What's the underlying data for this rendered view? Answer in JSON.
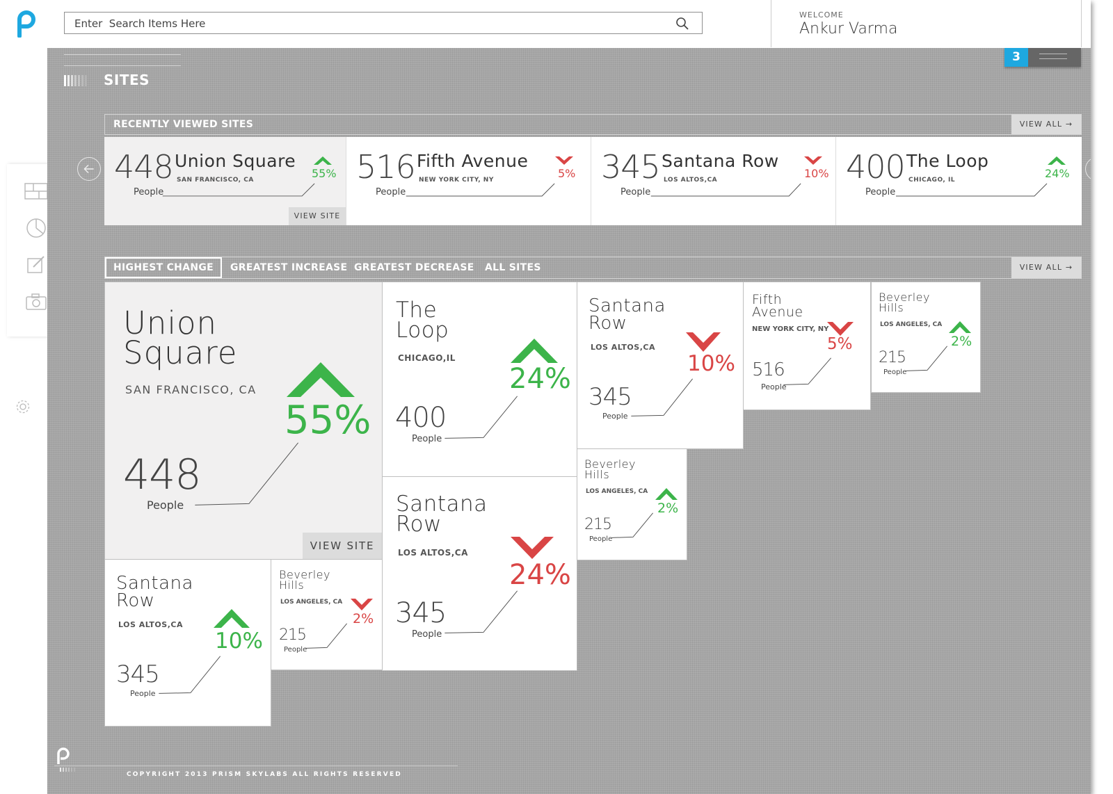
{
  "search": {
    "placeholder": "Enter  Search Items Here"
  },
  "user": {
    "welcome": "WELCOME",
    "name": "Ankur Varma"
  },
  "notifications": {
    "count": "3"
  },
  "sidebar": {
    "icons": [
      "grid-icon",
      "pie-chart-icon",
      "edit-icon",
      "camera-icon"
    ],
    "settings_icon": "gear-icon"
  },
  "page": {
    "title": "SITES"
  },
  "recent": {
    "header": "RECENTLY VIEWED SITES",
    "view_all": "VIEW ALL →",
    "view_site": "VIEW SITE",
    "cards": [
      {
        "count": "448",
        "people": "People",
        "name": "Union Square",
        "location": "SAN FRANCISCO, CA",
        "change": "55%",
        "direction": "up"
      },
      {
        "count": "516",
        "people": "People",
        "name": "Fifth Avenue",
        "location": "NEW YORK CITY, NY",
        "change": "5%",
        "direction": "down"
      },
      {
        "count": "345",
        "people": "People",
        "name": "Santana Row",
        "location": "LOS ALTOS,CA",
        "change": "10%",
        "direction": "down"
      },
      {
        "count": "400",
        "people": "People",
        "name": "The Loop",
        "location": "CHICAGO, IL",
        "change": "24%",
        "direction": "up"
      }
    ]
  },
  "filters": {
    "tabs": [
      "HIGHEST CHANGE",
      "GREATEST INCREASE",
      "GREATEST DECREASE",
      "ALL SITES"
    ],
    "active": "HIGHEST CHANGE",
    "view_all": "VIEW ALL →"
  },
  "tiles": [
    {
      "name": "Union Square",
      "location": "SAN FRANCISCO, CA",
      "count": "448",
      "people": "People",
      "change": "55%",
      "direction": "up",
      "action": "VIEW SITE"
    },
    {
      "name": "The Loop",
      "location": "CHICAGO,IL",
      "count": "400",
      "people": "People",
      "change": "24%",
      "direction": "up"
    },
    {
      "name": "Santana Row",
      "location": "LOS ALTOS,CA",
      "count": "345",
      "people": "People",
      "change": "10%",
      "direction": "down"
    },
    {
      "name": "Fifth Avenue",
      "location": "NEW YORK CITY, NY",
      "count": "516",
      "people": "People",
      "change": "5%",
      "direction": "down"
    },
    {
      "name": "Beverley Hills",
      "location": "LOS ANGELES, CA",
      "count": "215",
      "people": "People",
      "change": "2%",
      "direction": "up"
    },
    {
      "name": "Beverley Hills",
      "location": "LOS ANGELES, CA",
      "count": "215",
      "people": "People",
      "change": "2%",
      "direction": "up"
    },
    {
      "name": "Santana Row",
      "location": "LOS ALTOS,CA",
      "count": "345",
      "people": "People",
      "change": "24%",
      "direction": "down"
    },
    {
      "name": "Santana Row",
      "location": "LOS ALTOS,CA",
      "count": "345",
      "people": "People",
      "change": "10%",
      "direction": "up"
    },
    {
      "name": "Beverley Hills",
      "location": "LOS ANGELES, CA",
      "count": "215",
      "people": "People",
      "change": "2%",
      "direction": "down"
    }
  ],
  "colors": {
    "increase": "#3cb44a",
    "decrease": "#d94545",
    "accent": "#1ea8e0"
  },
  "footer": {
    "copyright": "COPYRIGHT 2013   PRISM SKYLABS   ALL RIGHTS RESERVED"
  }
}
